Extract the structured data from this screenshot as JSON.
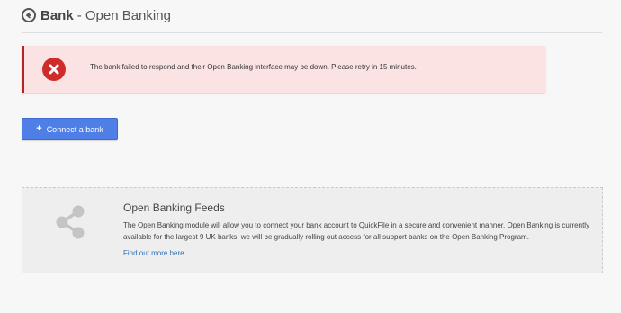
{
  "header": {
    "back_icon": "back-arrow-circle-icon",
    "title_bold": "Bank",
    "title_rest": "- Open Banking"
  },
  "alert": {
    "icon": "error-x-circle-icon",
    "message": "The bank failed to respond and their Open Banking interface may be down. Please retry in 15 minutes.",
    "background_color": "#fbe3e3",
    "border_color": "#b32424",
    "icon_color": "#d02b2b"
  },
  "connect_button": {
    "icon": "plus-icon",
    "plus_glyph": "+",
    "label": "Connect a bank",
    "color": "#4f7fe6"
  },
  "feeds_panel": {
    "icon": "share-icon",
    "title": "Open Banking Feeds",
    "description": "The Open Banking module will allow you to connect your bank account to QuickFile in a secure and convenient manner. Open Banking is currently available for the largest 9 UK banks, we will be gradually rolling out access for all support banks on the Open Banking Program.",
    "link_text": "Find out more here.."
  }
}
